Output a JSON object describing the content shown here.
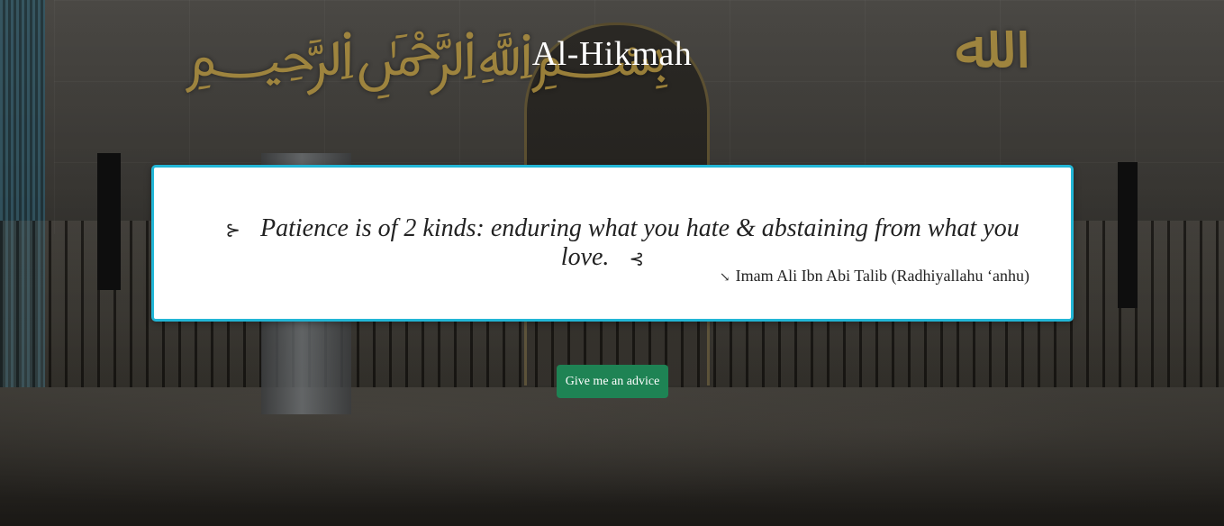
{
  "app": {
    "title": "Al-Hikmah"
  },
  "quote_card": {
    "open_mark_icon": "quote-open-icon",
    "open_mark": "⊱",
    "text": "Patience is of 2 kinds: enduring what you hate & abstaining from what you love.",
    "close_mark_icon": "quote-close-icon",
    "close_mark": "⊰",
    "author_icon": "pointing-hand-icon",
    "author_mark": "↘",
    "author": "Imam Ali Ibn Abi Talib (Radhiyallahu ‘anhu)",
    "border_color": "#22b6d6"
  },
  "actions": {
    "advice_button_label": "Give me an advice",
    "advice_button_color": "#1e8354"
  },
  "background": {
    "calligraphy_left_icon": "calligraphy-muhammad-icon",
    "calligraphy_right_icon": "calligraphy-allah-icon"
  }
}
